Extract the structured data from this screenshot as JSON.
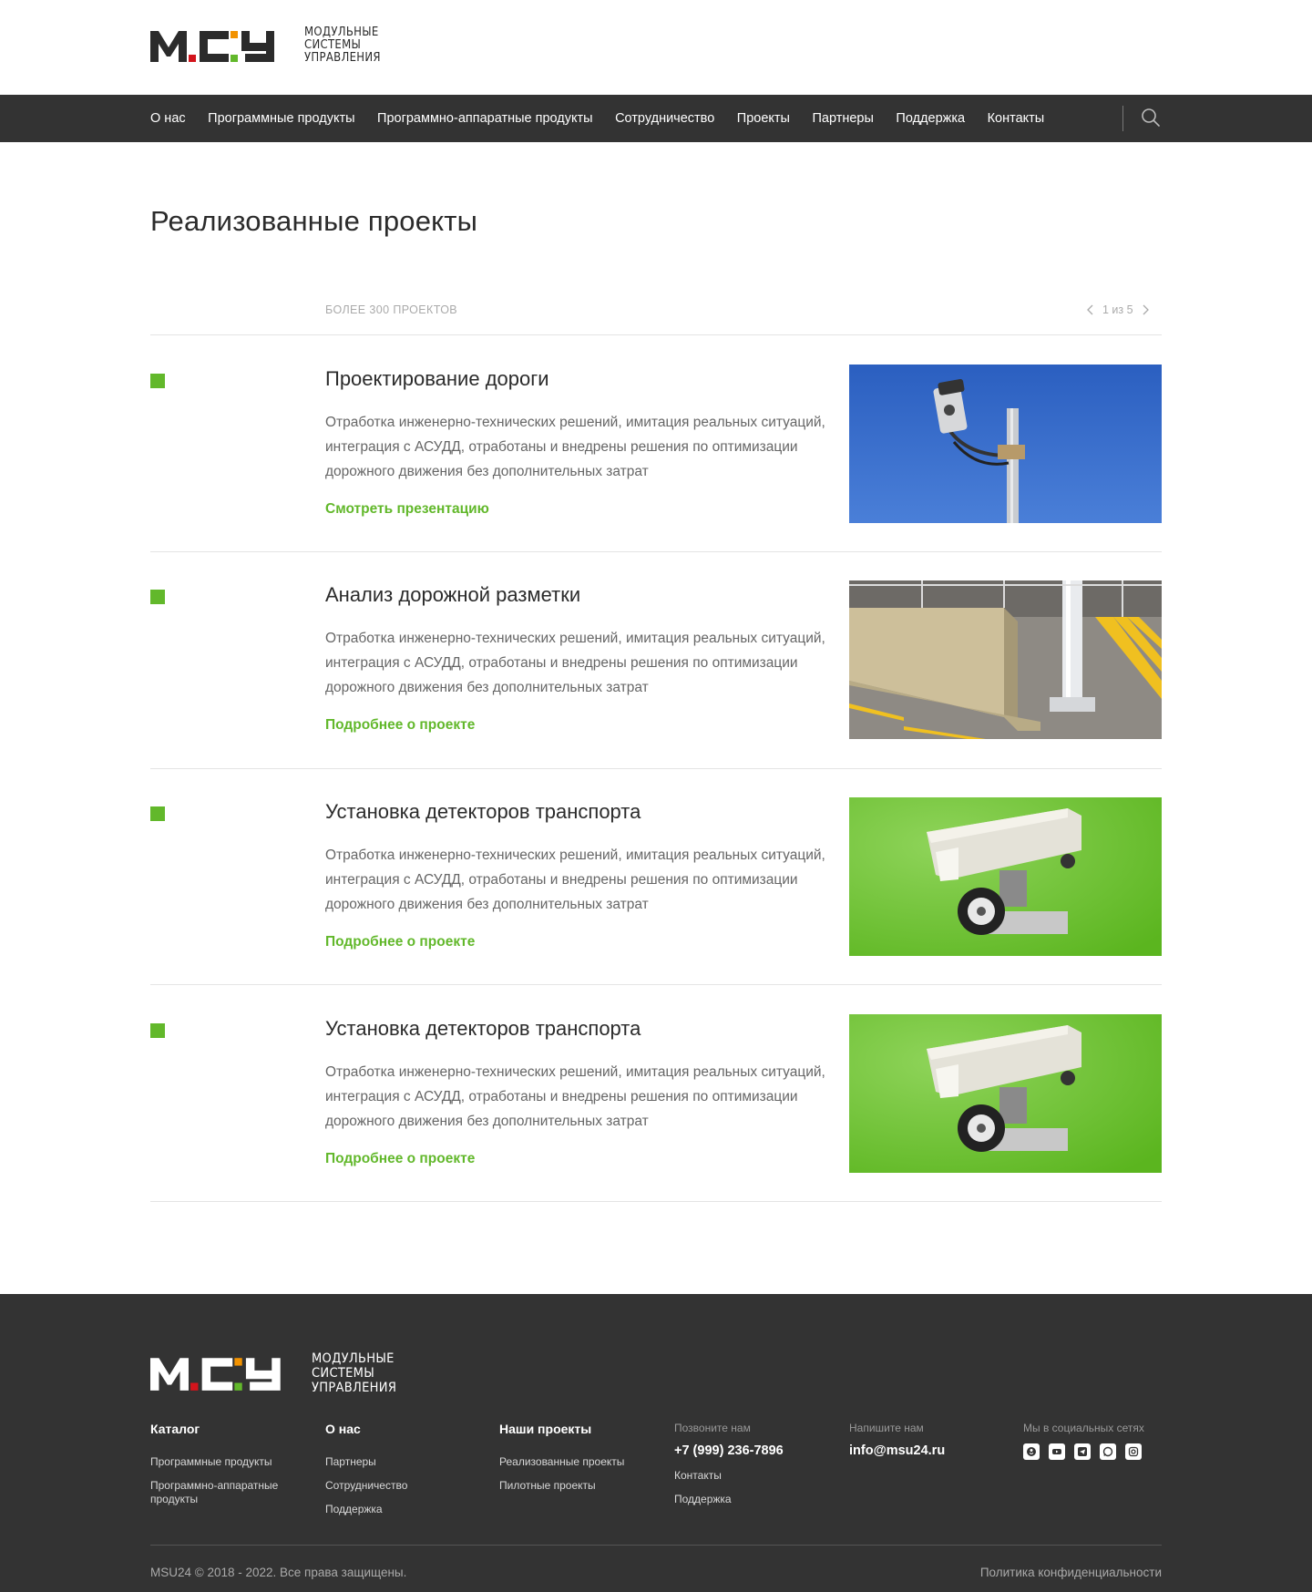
{
  "logo": {
    "mark": "МСУ",
    "line1": "МОДУЛЬНЫЕ",
    "line2": "СИСТЕМЫ",
    "line3": "УПРАВЛЕНИЯ"
  },
  "nav": {
    "items": [
      "О нас",
      "Программные продукты",
      "Программно-аппаратные продукты",
      "Сотрудничество",
      "Проекты",
      "Партнеры",
      "Поддержка",
      "Контакты"
    ],
    "search_icon": "search-icon"
  },
  "page_title": "Реализованные проекты",
  "list_header": {
    "count_label": "БОЛЕЕ 300 ПРОЕКТОВ",
    "pager": "1 из 5"
  },
  "projects": [
    {
      "title": "Проектирование дороги",
      "description": "Отработка инженерно-технических решений, имитация реальных ситуаций, интеграция с АСУДД, отработаны и внедрены решения по оптимизации дорожного движения без дополнительных затрат",
      "link": "Смотреть презентацию",
      "image": "camera-on-pole-sky"
    },
    {
      "title": "Анализ дорожной разметки",
      "description": "Отработка инженерно-технических решений, имитация реальных ситуаций, интеграция с АСУДД, отработаны и внедрены решения по оптимизации дорожного движения без дополнительных затрат",
      "link": "Подробнее о проекте",
      "image": "road-markings"
    },
    {
      "title": "Установка детекторов транспорта",
      "description": "Отработка инженерно-технических решений, имитация реальных ситуаций, интеграция с АСУДД, отработаны и внедрены решения по оптимизации дорожного движения без дополнительных затрат",
      "link": "Подробнее о проекте",
      "image": "camera-green"
    },
    {
      "title": "Установка детекторов транспорта",
      "description": "Отработка инженерно-технических решений, имитация реальных ситуаций, интеграция с АСУДД, отработаны и внедрены решения по оптимизации дорожного движения без дополнительных затрат",
      "link": "Подробнее о проекте",
      "image": "camera-green"
    }
  ],
  "footer": {
    "catalog": {
      "title": "Каталог",
      "links": [
        "Программные продукты",
        "Программно-аппаратные продукты"
      ]
    },
    "about": {
      "title": "О нас",
      "links": [
        "Партнеры",
        "Сотрудничество",
        "Поддержка"
      ]
    },
    "projects": {
      "title": "Наши проекты",
      "links": [
        "Реализованные проекты",
        "Пилотные проекты"
      ]
    },
    "call": {
      "caption": "Позвоните нам",
      "phone": "+7 (999) 236-7896",
      "links": [
        "Контакты",
        "Поддержка"
      ]
    },
    "write": {
      "caption": "Напишите нам",
      "email": "info@msu24.ru"
    },
    "social": {
      "caption": "Мы в социальных сетях",
      "icons": [
        "odnoklassniki-icon",
        "youtube-icon",
        "telegram-icon",
        "whatsapp-icon",
        "instagram-icon"
      ]
    },
    "copyright": "MSU24 © 2018 - 2022. Все права защищены.",
    "policy": "Политика конфиденциальности"
  },
  "colors": {
    "accent_green": "#62b82b",
    "logo_red": "#d3141c",
    "logo_orange": "#f29200",
    "dark": "#333333"
  }
}
